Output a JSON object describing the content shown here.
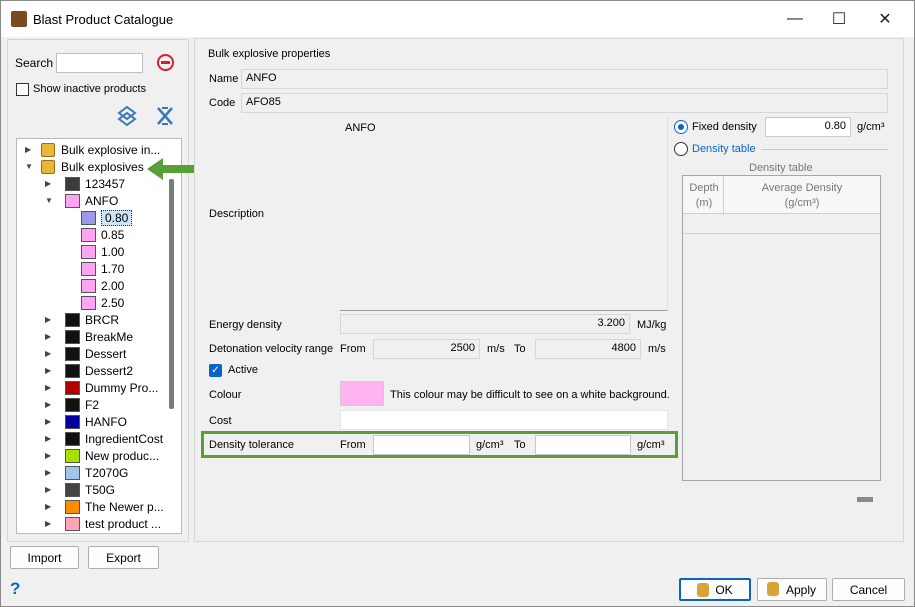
{
  "window": {
    "title": "Blast Product Catalogue"
  },
  "left_panel": {
    "search_label": "Search",
    "search_value": "",
    "show_inactive_label": "Show inactive products",
    "tree": [
      {
        "label": "Bulk explosive in...",
        "type": "group",
        "expanded": false
      },
      {
        "label": "Bulk explosives",
        "type": "group",
        "expanded": true
      },
      {
        "label": "123457",
        "color": "#3c3c3c",
        "level": 1
      },
      {
        "label": "ANFO",
        "color": "#ffa3f3",
        "level": 1,
        "expanded": true
      },
      {
        "label": "0.80",
        "color": "#9a9ae8",
        "level": 2,
        "selected": true
      },
      {
        "label": "0.85",
        "color": "#ffa3f3",
        "level": 2
      },
      {
        "label": "1.00",
        "color": "#ffa3f3",
        "level": 2
      },
      {
        "label": "1.70",
        "color": "#ffa3f3",
        "level": 2
      },
      {
        "label": "2.00",
        "color": "#ffa3f3",
        "level": 2
      },
      {
        "label": "2.50",
        "color": "#ffa3f3",
        "level": 2
      },
      {
        "label": "BRCR",
        "color": "#111111",
        "level": 1
      },
      {
        "label": "BreakMe",
        "color": "#111111",
        "level": 1
      },
      {
        "label": "Dessert",
        "color": "#111111",
        "level": 1
      },
      {
        "label": "Dessert2",
        "color": "#111111",
        "level": 1
      },
      {
        "label": "Dummy Pro...",
        "color": "#b00000",
        "level": 1
      },
      {
        "label": "F2",
        "color": "#111111",
        "level": 1
      },
      {
        "label": "HANFO",
        "color": "#0000a0",
        "level": 1
      },
      {
        "label": "IngredientCost",
        "color": "#111111",
        "level": 1
      },
      {
        "label": "New produc...",
        "color": "#a8e000",
        "level": 1
      },
      {
        "label": "T2070G",
        "color": "#9ec6ea",
        "level": 1
      },
      {
        "label": "T50G",
        "color": "#444444",
        "level": 1
      },
      {
        "label": "The Newer p...",
        "color": "#ff8c00",
        "level": 1
      },
      {
        "label": "test product ...",
        "color": "#ffa3b5",
        "level": 1
      }
    ],
    "import_label": "Import",
    "export_label": "Export"
  },
  "properties": {
    "group_title": "Bulk explosive properties",
    "name_label": "Name",
    "name_value": "ANFO",
    "code_label": "Code",
    "code_value": "AFO85",
    "description_label": "Description",
    "description_value": "ANFO",
    "energy_label": "Energy density",
    "energy_value": "3.200",
    "energy_unit": "MJ/kg",
    "detonation_label": "Detonation velocity range",
    "from_label": "From",
    "to_label": "To",
    "det_from": "2500",
    "det_to": "4800",
    "det_unit": "m/s",
    "active_label": "Active",
    "colour_label": "Colour",
    "colour_value": "#ffb3f0",
    "colour_warning": "This colour may be difficult to see on a white background.",
    "cost_label": "Cost",
    "tolerance_label": "Density tolerance",
    "tol_unit": "g/cm³",
    "fixed_density_label": "Fixed density",
    "fixed_density_value": "0.80",
    "density_unit": "g/cm³",
    "density_table_label": "Density table",
    "density_table_title": "Density table",
    "col_depth": "Depth",
    "col_depth_unit": "(m)",
    "col_avg": "Average Density",
    "col_avg_unit": "(g/cm³)"
  },
  "footer": {
    "ok_label": "OK",
    "apply_label": "Apply",
    "cancel_label": "Cancel"
  },
  "colors": {
    "highlight": "#5a9e3a",
    "accent": "#0a64c8"
  }
}
